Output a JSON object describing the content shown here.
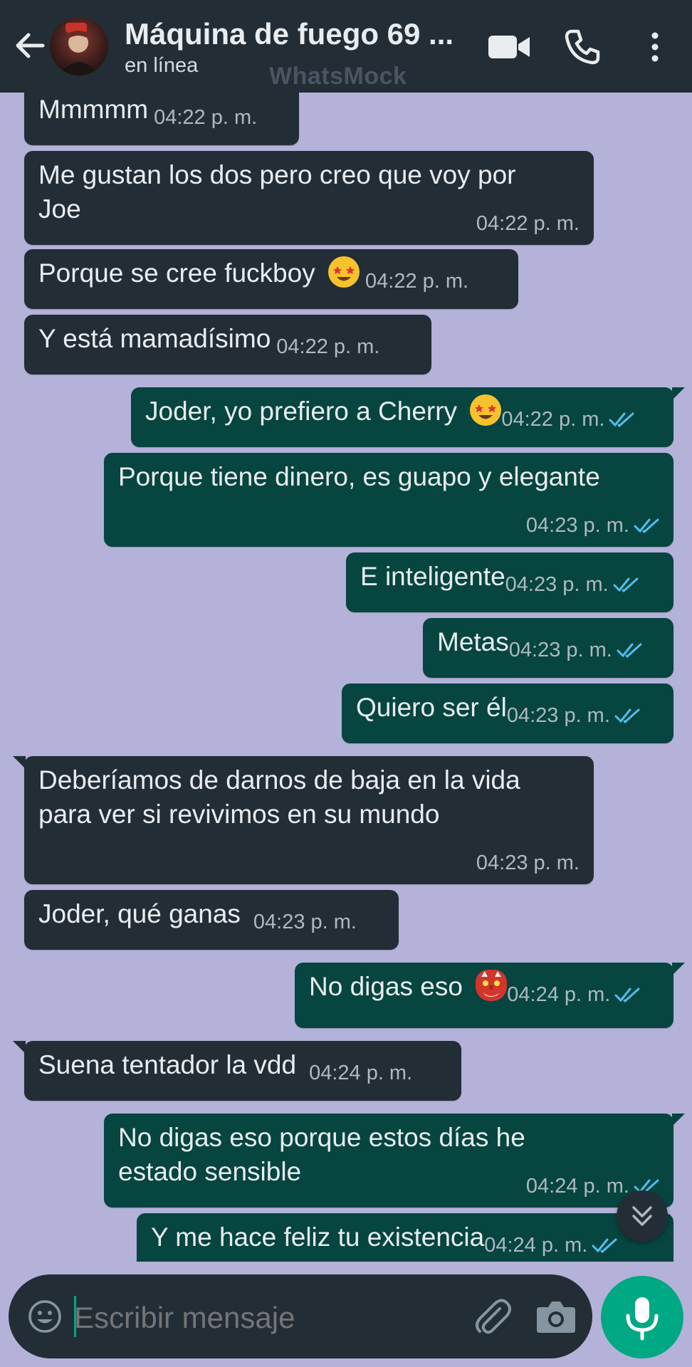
{
  "header": {
    "contact_name": "Máquina de fuego 69 ...",
    "status": "en línea",
    "watermark": "WhatsMock"
  },
  "messages": [
    {
      "dir": "in",
      "text": "Mmmmm",
      "time": "04:22 p. m."
    },
    {
      "dir": "in",
      "text": "Me gustan los dos pero creo que voy por Joe",
      "time": "04:22 p. m."
    },
    {
      "dir": "in",
      "text": "Porque se cree fuckboy",
      "emoji": "star-struck-emoji",
      "time": "04:22 p. m."
    },
    {
      "dir": "in",
      "text": "Y está mamadísimo",
      "time": "04:22 p. m."
    },
    {
      "dir": "out",
      "text": "Joder, yo prefiero a Cherry",
      "emoji": "star-struck-emoji",
      "time": "04:22 p. m.",
      "read": true
    },
    {
      "dir": "out",
      "text": "Porque tiene dinero, es guapo y elegante",
      "time": "04:23 p. m.",
      "read": true
    },
    {
      "dir": "out",
      "text": "E inteligente",
      "time": "04:23 p. m.",
      "read": true
    },
    {
      "dir": "out",
      "text": "Metas",
      "time": "04:23 p. m.",
      "read": true
    },
    {
      "dir": "out",
      "text": "Quiero ser él",
      "time": "04:23 p. m.",
      "read": true
    },
    {
      "dir": "in",
      "text": "Deberíamos de darnos de baja en la vida para ver si revivimos en su mundo",
      "time": "04:23 p. m."
    },
    {
      "dir": "in",
      "text": "Joder, qué ganas",
      "time": "04:23 p. m."
    },
    {
      "dir": "out",
      "text": "No digas eso",
      "emoji": "goblin-mask-emoji",
      "time": "04:24 p. m.",
      "read": true
    },
    {
      "dir": "in",
      "text": "Suena tentador la vdd",
      "time": "04:24 p. m."
    },
    {
      "dir": "out",
      "text": "No digas eso porque estos días he estado sensible",
      "time": "04:24 p. m.",
      "read": true
    },
    {
      "dir": "out",
      "text": "Y me hace feliz tu existencia",
      "time": "04:24 p. m.",
      "read": true
    }
  ],
  "input": {
    "placeholder": "Escribir mensaje",
    "value": ""
  },
  "colors": {
    "header_bg": "#232d36",
    "chat_bg": "#b4b2d8",
    "incoming_bubble": "#232d36",
    "outgoing_bubble": "#064540",
    "read_tick": "#53bdeb",
    "accent": "#00a884"
  },
  "icons": {
    "back": "arrow-left-icon",
    "video": "video-camera-icon",
    "call": "phone-icon",
    "menu": "more-vertical-icon",
    "emoji": "smiley-icon",
    "attach": "paperclip-icon",
    "camera": "camera-icon",
    "mic": "microphone-icon",
    "scroll": "double-chevron-down-icon"
  }
}
